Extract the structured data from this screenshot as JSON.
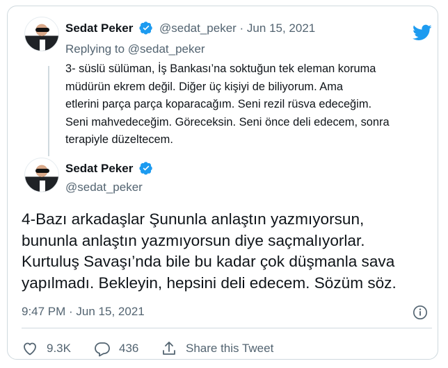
{
  "brand": {
    "twitter_blue": "#1d9bf0",
    "icon": "twitter-bird-icon"
  },
  "reply_tweet": {
    "author_name": "Sedat Peker",
    "handle_date": "@sedat_peker · Jun 15, 2021",
    "replying_to": "Replying to @sedat_peker",
    "text_lines": [
      "3- süslü sülüman, İş Bankası’na soktuğun tek eleman koruma",
      "müdürün ekrem değil. Diğer üç kişiyi de biliyorum. Ama",
      "etlerini parça parça koparacağım. Seni rezil rüsva edeceğim.",
      "Seni mahvedeceğim. Göreceksin. Seni önce deli edecem, sonra",
      "terapiyle düzeltecem."
    ]
  },
  "main_tweet": {
    "author_name": "Sedat Peker",
    "handle": "@sedat_peker",
    "text_lines": [
      "4-Bazı arkadaşlar Şununla anlaştın yazmıyorsun,",
      "bununla anlaştın yazmıyorsun diye saçmalıyorlar.",
      "Kurtuluş Savaşı’nda bile bu kadar çok düşmanla sava",
      "yapılmadı. Bekleyin, hepsini deli edecem. Sözüm söz."
    ],
    "timestamp": "9:47 PM · Jun 15, 2021"
  },
  "actions": {
    "likes": "9.3K",
    "replies": "436",
    "share_label": "Share this Tweet"
  }
}
